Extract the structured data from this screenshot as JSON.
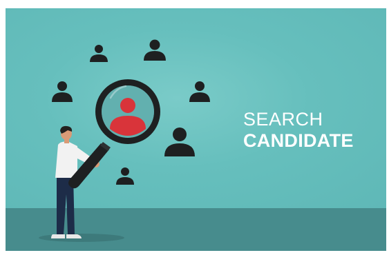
{
  "headline": {
    "line1": "SEARCH",
    "line2": "CANDIDATE"
  },
  "colors": {
    "wall": "#63bdbc",
    "wall_glow": "#78c9c7",
    "floor": "#468b8c",
    "floor_shadow": "#3b7677",
    "person_icon": "#1e2021",
    "highlighted_candidate": "#d9343a",
    "lens": "#5aa7a6",
    "shirt": "#f2f2f2",
    "pants": "#1d2c48",
    "skin": "#d99b77",
    "hair": "#23211f",
    "text": "#ffffff"
  },
  "icons": [
    "candidate-icon",
    "magnifying-glass-icon",
    "selected-candidate-icon",
    "recruiter-figure"
  ]
}
